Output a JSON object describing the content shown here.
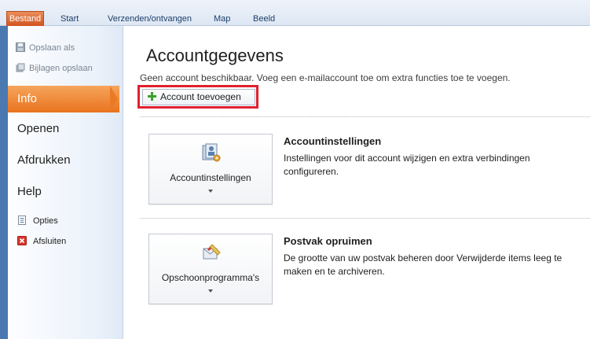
{
  "ribbon": {
    "tabs": [
      "Bestand",
      "Start",
      "Verzenden/ontvangen",
      "Map",
      "Beeld"
    ]
  },
  "nav": {
    "save_as": "Opslaan als",
    "save_attachments": "Bijlagen opslaan",
    "info": "Info",
    "open": "Openen",
    "print": "Afdrukken",
    "help": "Help",
    "options": "Opties",
    "exit": "Afsluiten"
  },
  "main": {
    "title": "Accountgegevens",
    "subtitle": "Geen account beschikbaar. Voeg een e-mailaccount toe om extra functies toe te voegen.",
    "add_account": "Account toevoegen",
    "sections": [
      {
        "button_label": "Accountinstellingen",
        "title": "Accountinstellingen",
        "description": "Instellingen voor dit account wijzigen en extra verbindingen configureren."
      },
      {
        "button_label": "Opschoonprogramma's",
        "title": "Postvak opruimen",
        "description": "De grootte van uw postvak beheren door Verwijderde items leeg te maken en te archiveren."
      }
    ]
  },
  "colors": {
    "file_tab": "#d1531e",
    "info_active": "#e8731e",
    "highlight_box": "#e0212f",
    "left_bar": "#4a78b0"
  },
  "icons": [
    "save-as-icon",
    "attachments-icon",
    "options-icon",
    "exit-icon",
    "plus-icon",
    "account-settings-icon",
    "cleanup-icon"
  ]
}
